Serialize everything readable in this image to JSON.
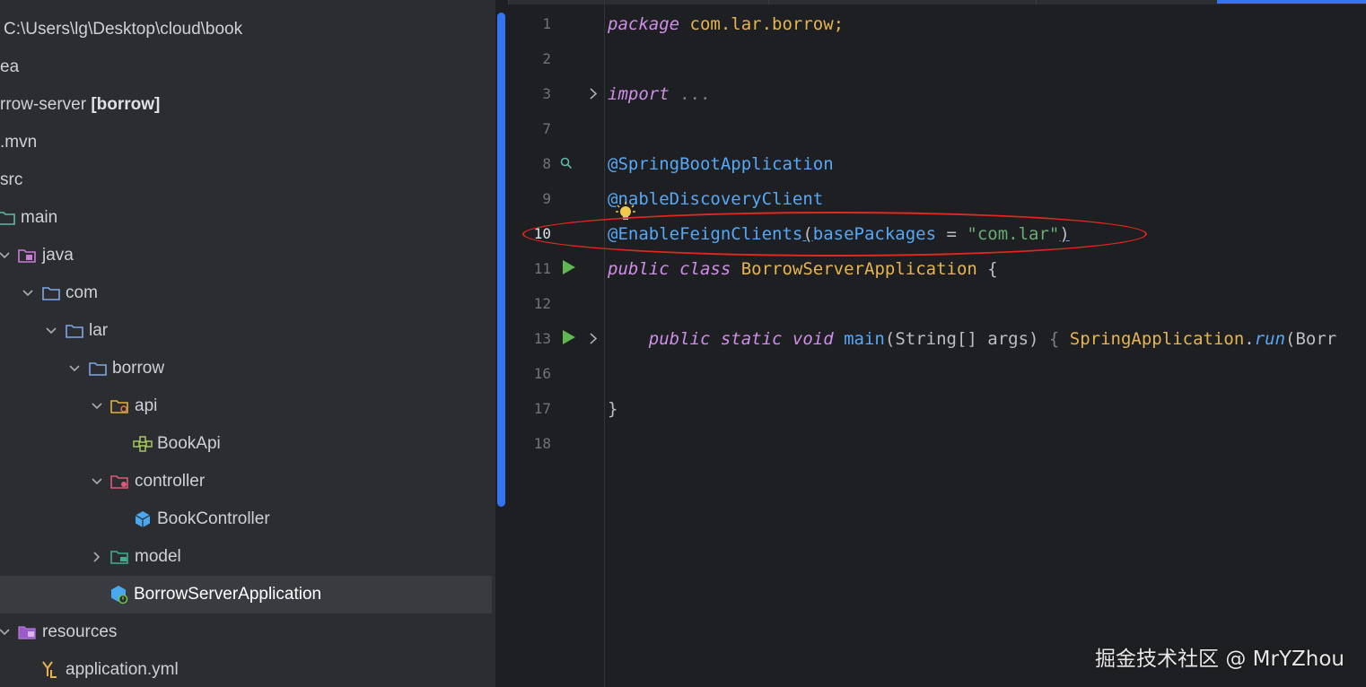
{
  "project_tree": {
    "items": [
      {
        "label": "C:\\Users\\lg\\Desktop\\cloud\\book",
        "bold": "",
        "icon": "none",
        "chevron": "none"
      },
      {
        "label": "ea",
        "bold": "",
        "icon": "none",
        "chevron": "none"
      },
      {
        "label": "rrow-server ",
        "bold": "[borrow]",
        "icon": "none",
        "chevron": "none"
      },
      {
        "label": ".mvn",
        "bold": "",
        "icon": "none",
        "chevron": "none"
      },
      {
        "label": "src",
        "bold": "",
        "icon": "none",
        "chevron": "none"
      },
      {
        "label": "main",
        "bold": "",
        "icon": "folder-icon",
        "chevron": "none"
      },
      {
        "label": "java",
        "bold": "",
        "icon": "java-source-folder-icon",
        "chevron": "down"
      },
      {
        "label": "com",
        "bold": "",
        "icon": "folder-icon",
        "chevron": "down"
      },
      {
        "label": "lar",
        "bold": "",
        "icon": "folder-icon",
        "chevron": "down"
      },
      {
        "label": "borrow",
        "bold": "",
        "icon": "folder-icon",
        "chevron": "down"
      },
      {
        "label": "api",
        "bold": "",
        "icon": "api-folder-icon",
        "chevron": "down"
      },
      {
        "label": "BookApi",
        "bold": "",
        "icon": "interface-icon",
        "chevron": "none"
      },
      {
        "label": "controller",
        "bold": "",
        "icon": "controller-folder-icon",
        "chevron": "down"
      },
      {
        "label": "BookController",
        "bold": "",
        "icon": "bean-class-icon",
        "chevron": "none"
      },
      {
        "label": "model",
        "bold": "",
        "icon": "model-folder-icon",
        "chevron": "right"
      },
      {
        "label": "BorrowServerApplication",
        "bold": "",
        "icon": "spring-boot-class-icon",
        "chevron": "none",
        "selected": true
      },
      {
        "label": "resources",
        "bold": "",
        "icon": "resources-folder-icon",
        "chevron": "down"
      },
      {
        "label": "application.yml",
        "bold": "",
        "icon": "yaml-file-icon",
        "chevron": "none"
      }
    ]
  },
  "editor": {
    "lines": [
      {
        "n": "1"
      },
      {
        "n": "2"
      },
      {
        "n": "3"
      },
      {
        "n": "7"
      },
      {
        "n": "8"
      },
      {
        "n": "9"
      },
      {
        "n": "10"
      },
      {
        "n": "11"
      },
      {
        "n": "12"
      },
      {
        "n": "13"
      },
      {
        "n": "16"
      },
      {
        "n": "17"
      },
      {
        "n": "18"
      }
    ],
    "code": {
      "l1_kw": "package",
      "l1_pkg": " com.lar.borrow;",
      "l3_kw": "import",
      "l3_fold": " ...",
      "l8_ann": "@SpringBootApplication",
      "l9_at": "@",
      "l9_ann": "nableDiscoveryClient",
      "l10_ann": "@EnableFeignClients",
      "l10_open": "(",
      "l10_param": "basePackages",
      "l10_eq": " = ",
      "l10_str": "\"com.lar\"",
      "l10_close": ")",
      "l11_kw1": "public",
      "l11_kw2": "class",
      "l11_name": " BorrowServerApplication ",
      "l11_brace": "{",
      "l13_kw": "public static void",
      "l13_meth": " main",
      "l13_sig": "(String[] args) ",
      "l13_fold": "{",
      "l13_type": " SpringApplication",
      "l13_dot": ".",
      "l13_run": "run",
      "l13_tail": "(Borr",
      "l17_brace": "}"
    }
  },
  "watermark": "掘金技术社区 @ MrYZhou",
  "colors": {
    "accent": "#3574f0",
    "highlight_ellipse": "#e0281f"
  }
}
